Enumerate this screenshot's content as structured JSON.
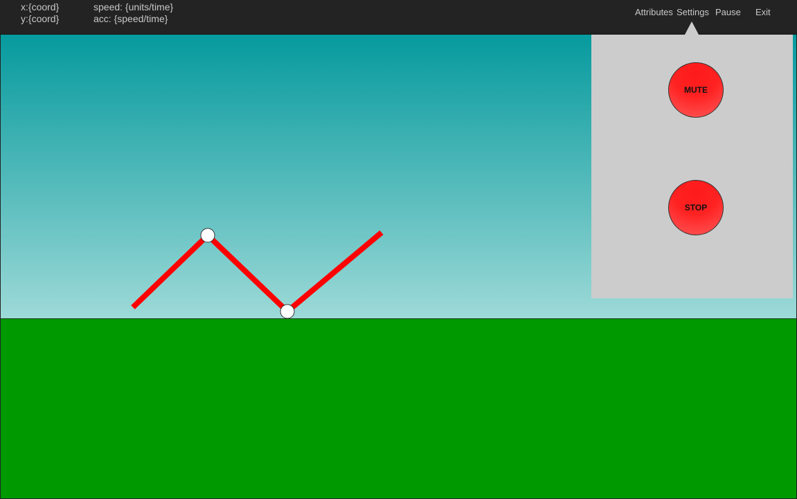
{
  "hud": {
    "x": "x:{coord}",
    "y": "y:{coord}",
    "speed": "speed: {units/time}",
    "acc": "acc: {speed/time}"
  },
  "menu": {
    "attributes": "Attributes",
    "settings": "Settings",
    "pause": "Pause",
    "exit": "Exit"
  },
  "settings_panel": {
    "mute_label": "MUTE",
    "stop_label": "STOP"
  },
  "colors": {
    "topbar": "#232323",
    "sky_top": "#069a9e",
    "sky_bottom": "#9ddad8",
    "ground": "#009900",
    "leg": "#ff0000",
    "joint": "#ffffff",
    "panel": "#cccccc",
    "button": "#ff2222"
  }
}
